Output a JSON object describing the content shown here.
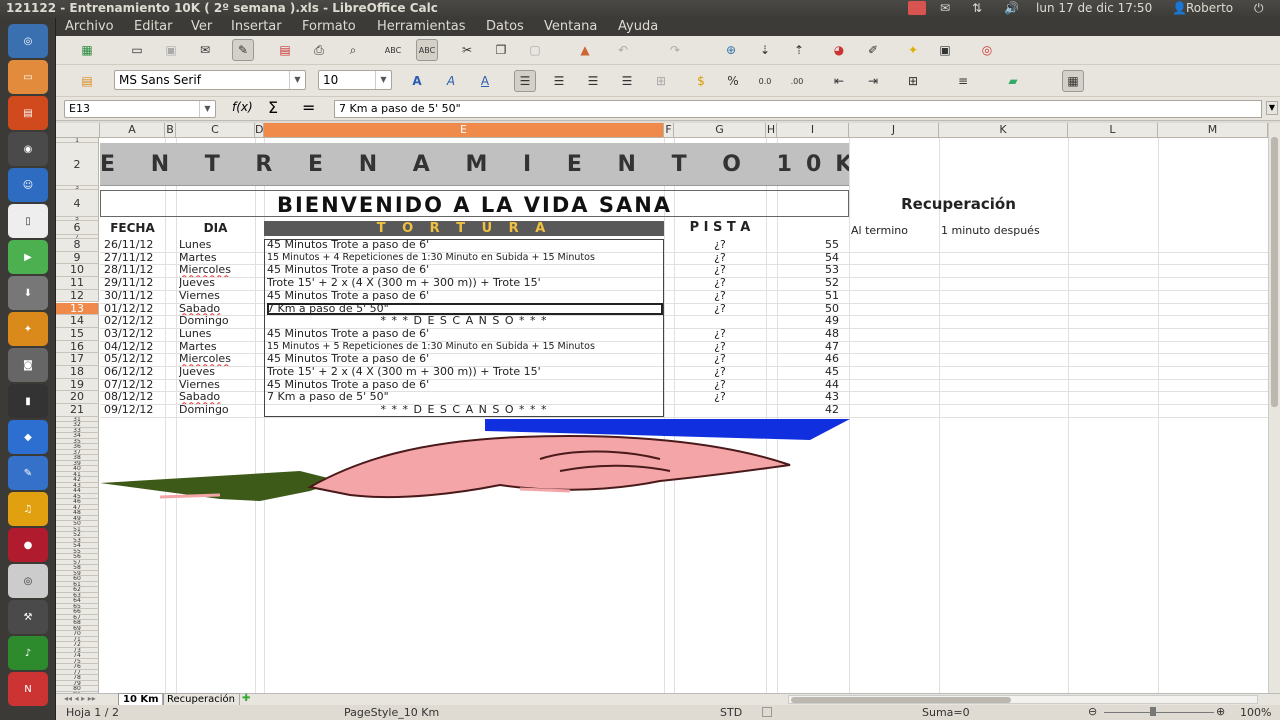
{
  "window": {
    "title": "121122 - Entrenamiento 10K ( 2º semana ).xls - LibreOffice Calc",
    "clock": "lun 17 de dic 17:50",
    "user": "Roberto"
  },
  "menu": [
    "Archivo",
    "Editar",
    "Ver",
    "Insertar",
    "Formato",
    "Herramientas",
    "Datos",
    "Ventana",
    "Ayuda"
  ],
  "format": {
    "font": "MS Sans Serif",
    "size": "10"
  },
  "formula_bar": {
    "cell_ref": "E13",
    "content": "7 Km  a paso de 5' 50\""
  },
  "columns": [
    "A",
    "B",
    "C",
    "D",
    "E",
    "F",
    "G",
    "H",
    "I",
    "J",
    "K",
    "L",
    "M"
  ],
  "sheet": {
    "title": "E N T R E N A M I E N T O   10K",
    "welcome": "BIENVENIDO  A  LA  VIDA  SANA",
    "recovery_title": "Recuperación",
    "headers": {
      "fecha": "FECHA",
      "dia": "DIA",
      "tortura": "T O R T U R A",
      "pista": "P I S T A"
    },
    "recovery_note": {
      "label": "Al termino",
      "value": "1 minuto después"
    },
    "rows": [
      {
        "num": "8",
        "fecha": "26/11/12",
        "dia": "Lunes",
        "tortura": "45  Minutos  Trote a paso de 6'",
        "pista": "¿?",
        "count": "55",
        "small": false,
        "center": false
      },
      {
        "num": "9",
        "fecha": "27/11/12",
        "dia": "Martes",
        "tortura": "15 Minutos + 4  Repeticiones de 1:30 Minuto  en Subida + 15 Minutos",
        "pista": "¿?",
        "count": "54",
        "small": true,
        "center": false
      },
      {
        "num": "10",
        "fecha": "28/11/12",
        "dia": "Miercoles",
        "tortura": "45  Minutos  Trote a paso de 6'",
        "pista": "¿?",
        "count": "53",
        "small": false,
        "center": false
      },
      {
        "num": "11",
        "fecha": "29/11/12",
        "dia": "Jueves",
        "tortura": "Trote 15' + 2 x (4 X (300 m + 300 m)) + Trote 15'",
        "pista": "¿?",
        "count": "52",
        "small": false,
        "center": false
      },
      {
        "num": "12",
        "fecha": "30/11/12",
        "dia": "Viernes",
        "tortura": "45  Minutos  Trote a paso de 6'",
        "pista": "¿?",
        "count": "51",
        "small": false,
        "center": false
      },
      {
        "num": "13",
        "fecha": "01/12/12",
        "dia": "Sabado",
        "tortura": "7 Km  a paso de 5' 50\"",
        "pista": "¿?",
        "count": "50",
        "small": false,
        "center": false
      },
      {
        "num": "14",
        "fecha": "02/12/12",
        "dia": "Domingo",
        "tortura": "* * *     D E S C A N S O     * * *",
        "pista": "",
        "count": "49",
        "small": false,
        "center": true
      },
      {
        "num": "15",
        "fecha": "03/12/12",
        "dia": "Lunes",
        "tortura": "45  Minutos  Trote a paso de 6'",
        "pista": "¿?",
        "count": "48",
        "small": false,
        "center": false
      },
      {
        "num": "16",
        "fecha": "04/12/12",
        "dia": "Martes",
        "tortura": "15 Minutos + 5  Repeticiones de 1:30 Minuto  en Subida + 15 Minutos",
        "pista": "¿?",
        "count": "47",
        "small": true,
        "center": false
      },
      {
        "num": "17",
        "fecha": "05/12/12",
        "dia": "Miercoles",
        "tortura": "45  Minutos  Trote a paso de 6'",
        "pista": "¿?",
        "count": "46",
        "small": false,
        "center": false
      },
      {
        "num": "18",
        "fecha": "06/12/12",
        "dia": "Jueves",
        "tortura": "Trote 15' + 2 x (4 X (300 m + 300 m)) + Trote 15'",
        "pista": "¿?",
        "count": "45",
        "small": false,
        "center": false
      },
      {
        "num": "19",
        "fecha": "07/12/12",
        "dia": "Viernes",
        "tortura": "45  Minutos  Trote a paso de 6'",
        "pista": "¿?",
        "count": "44",
        "small": false,
        "center": false
      },
      {
        "num": "20",
        "fecha": "08/12/12",
        "dia": "Sabado",
        "tortura": "7 Km  a paso de 5' 50\"",
        "pista": "¿?",
        "count": "43",
        "small": false,
        "center": false
      },
      {
        "num": "21",
        "fecha": "09/12/12",
        "dia": "Domingo",
        "tortura": "* * *     D E S C A N S O     * * *",
        "pista": "",
        "count": "42",
        "small": false,
        "center": true
      }
    ]
  },
  "tabs": [
    "10 Km",
    "Recuperación"
  ],
  "status": {
    "sheet": "Hoja 1 / 2",
    "style": "PageStyle_10 Km",
    "mode": "STD",
    "sum": "Suma=0",
    "zoom": "100%"
  },
  "colors": {
    "accent": "#f08a4b",
    "header_bg": "#c0c0c0",
    "tortura_bg": "#595959",
    "tortura_text": "#f0c040"
  }
}
